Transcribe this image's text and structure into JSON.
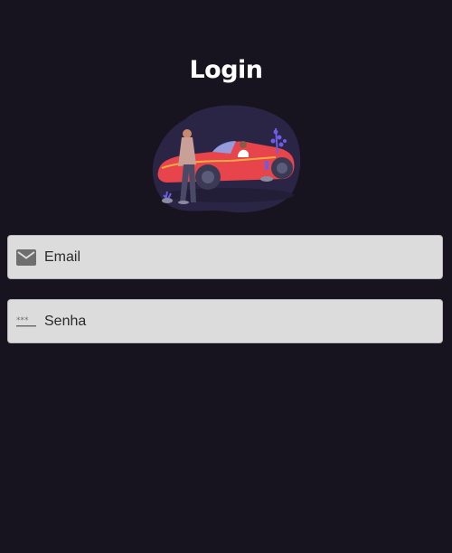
{
  "header": {
    "title": "Login"
  },
  "illustration": {
    "name": "person-with-red-convertible-car"
  },
  "form": {
    "email": {
      "placeholder": "Email",
      "value": "",
      "icon": "mail-icon"
    },
    "password": {
      "placeholder": "Senha",
      "value": "",
      "icon": "password-dots-icon"
    }
  },
  "colors": {
    "background": "#18141f",
    "field_background": "#dcdcdc",
    "accent_car": "#e8444b",
    "accent_plant": "#6c5ce7"
  }
}
